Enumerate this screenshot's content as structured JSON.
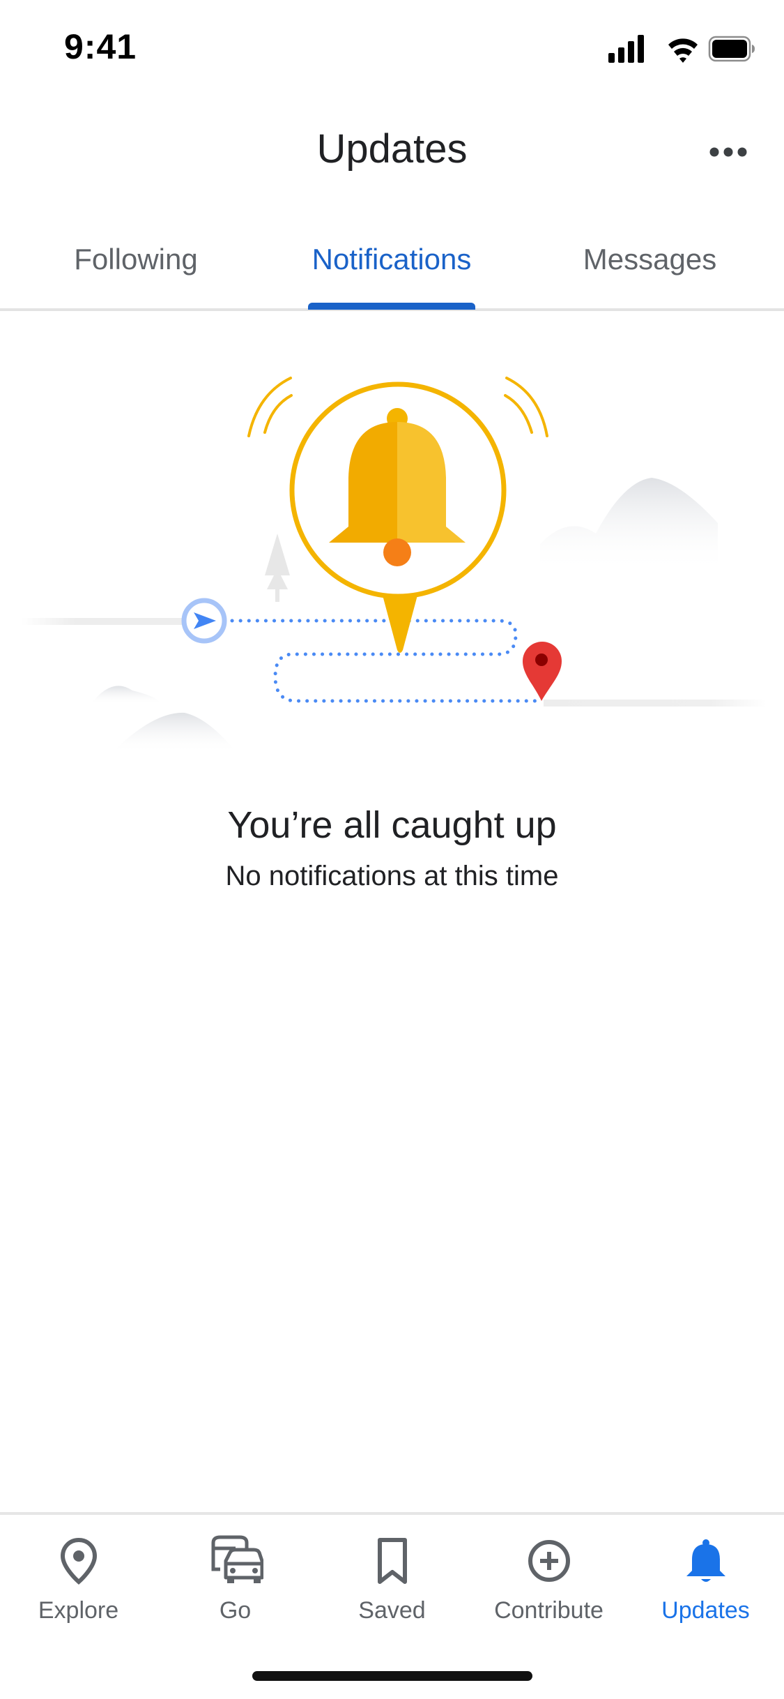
{
  "status_bar": {
    "time": "9:41",
    "icons": [
      "signal-icon",
      "wifi-icon",
      "battery-icon"
    ]
  },
  "header": {
    "title": "Updates",
    "more_icon": "more-horizontal-icon"
  },
  "tabs": [
    {
      "label": "Following",
      "active": false
    },
    {
      "label": "Notifications",
      "active": true
    },
    {
      "label": "Messages",
      "active": false
    }
  ],
  "empty_state": {
    "illustration": "bell-route-illustration",
    "title": "You’re all caught up",
    "subtitle": "No notifications at this time"
  },
  "bottom_nav": {
    "items": [
      {
        "label": "Explore",
        "icon": "location-pin-icon",
        "active": false
      },
      {
        "label": "Go",
        "icon": "commute-icon",
        "active": false
      },
      {
        "label": "Saved",
        "icon": "bookmark-icon",
        "active": false
      },
      {
        "label": "Contribute",
        "icon": "add-circle-icon",
        "active": false
      },
      {
        "label": "Updates",
        "icon": "bell-icon",
        "active": true
      }
    ]
  },
  "colors": {
    "accent": "#1a73e8",
    "tab_active": "#1a62c8",
    "text_primary": "#202124",
    "text_secondary": "#5f6368",
    "bell_yellow": "#f4b400",
    "pin_red": "#e53935"
  }
}
